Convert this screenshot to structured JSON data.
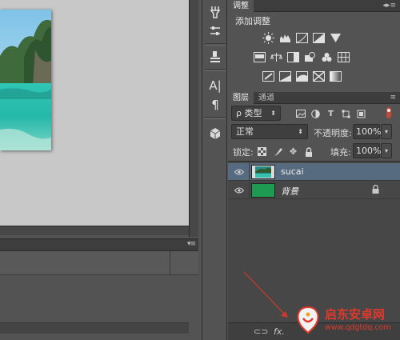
{
  "document": {
    "photo": "landscape-photo-lagoon"
  },
  "adjustments_panel": {
    "tabs": [
      "调整"
    ],
    "title": "添加调整",
    "icons_row1": [
      "brightness-contrast-icon",
      "levels-icon",
      "curves-icon",
      "exposure-icon",
      "vibrance-icon"
    ],
    "icons_row2": [
      "hue-saturation-icon",
      "color-balance-icon",
      "black-white-icon",
      "photo-filter-icon",
      "channel-mixer-icon",
      "color-lookup-icon"
    ],
    "icons_row3": [
      "invert-icon",
      "posterize-icon",
      "threshold-icon",
      "selective-color-icon",
      "gradient-map-icon"
    ]
  },
  "layers_panel": {
    "tabs": [
      "图层",
      "通道"
    ],
    "filter": {
      "label": "类型",
      "search_glyph": "ρ"
    },
    "filter_icons": [
      "pixel-filter-icon",
      "adjustment-filter-icon",
      "type-filter-icon",
      "shape-filter-icon",
      "smart-object-filter-icon"
    ],
    "blend_mode": "正常",
    "opacity_label": "不透明度:",
    "opacity_value": "100%",
    "lock_label": "锁定:",
    "fill_label": "填充:",
    "fill_value": "100%",
    "layers": [
      {
        "name": "sucai",
        "visible": true,
        "selected": true,
        "thumbnail": "landscape-photo-lagoon",
        "locked": false
      },
      {
        "name": "背景",
        "visible": true,
        "selected": false,
        "thumbnail_color": "#1e9a52",
        "locked": true
      }
    ],
    "footer_icons": [
      "link-icon",
      "fx-icon"
    ],
    "footer_fx_label": "fx."
  },
  "watermark": {
    "brand": "启东安卓网",
    "url": "www.qdgtdq.com",
    "accent": "#e0392b"
  }
}
